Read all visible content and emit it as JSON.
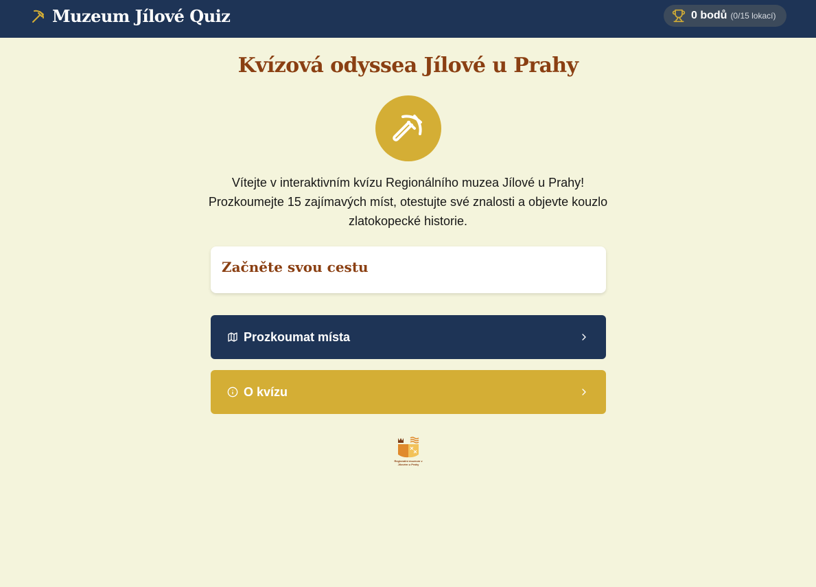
{
  "header": {
    "brand_title": "Muzeum Jílové Quiz",
    "brand_icon": "pickaxe-icon",
    "score": {
      "points_label": "0 bodů",
      "progress_label": "(0/15 lokací)",
      "icon": "trophy-icon"
    }
  },
  "main": {
    "title": "Kvízová odyssea Jílové u Prahy",
    "hero_icon": "pickaxe-icon",
    "intro_text": "Vítejte v interaktivním kvízu Regionálního muzea Jílové u Prahy! Prozkoumejte 15 zajímavých míst, otestujte své znalosti a objevte kouzlo zlatokopecké historie.",
    "start_card_title": "Začněte svou cestu",
    "buttons": [
      {
        "label": "Prozkoumat místa",
        "icon": "map-icon"
      },
      {
        "label": "O kvízu",
        "icon": "info-icon"
      }
    ],
    "footer_logo_text": "Regionální muzeum v Jílovém u Prahy"
  },
  "colors": {
    "navy": "#1e3456",
    "gold": "#d4ae35",
    "brown": "#8a3f12",
    "background": "#f4f4dc"
  }
}
